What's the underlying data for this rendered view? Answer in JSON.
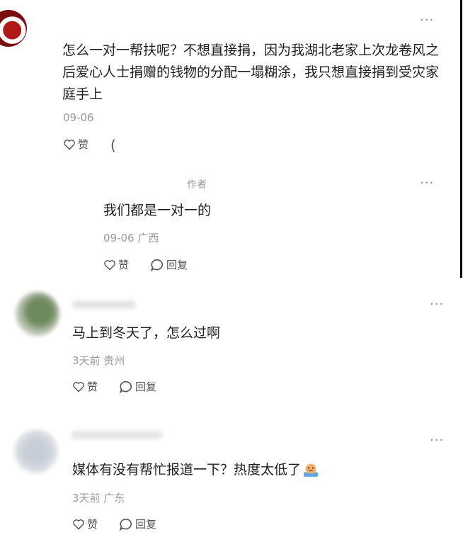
{
  "comments": [
    {
      "text": "怎么一对一帮扶呢？不想直接捐，因为我湖北老家上次龙卷风之后爱心人士捐赠的钱物的分配一塌糊涂，我只想直接捐到受灾家庭手上",
      "time": "09-06",
      "like_label": "赞",
      "reply_label": "(",
      "reply": {
        "badge": "作者",
        "text": "我们都是一对一的",
        "time": "09-06 广西",
        "like_label": "赞",
        "reply_label": "回复"
      }
    },
    {
      "text": "马上到冬天了，怎么过啊",
      "time": "3天前 贵州",
      "like_label": "赞",
      "reply_label": "回复"
    },
    {
      "text": "媒体有没有帮忙报道一下？热度太低了",
      "time": "3天前 广东",
      "like_label": "赞",
      "reply_label": "回复"
    }
  ],
  "more_label": "···",
  "colors": {
    "border": "#000000",
    "meta": "#9a9a9a",
    "text": "#1f1f1f"
  }
}
